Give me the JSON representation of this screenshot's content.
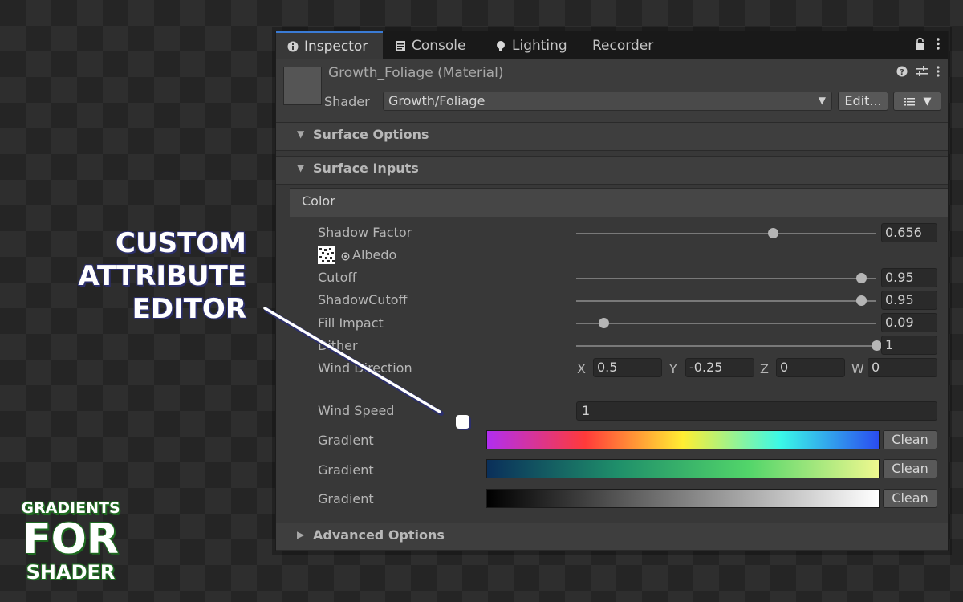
{
  "tabs": [
    {
      "label": "Inspector",
      "icon": "info-icon"
    },
    {
      "label": "Console",
      "icon": "console-icon"
    },
    {
      "label": "Lighting",
      "icon": "lightbulb-icon"
    },
    {
      "label": "Recorder",
      "icon": ""
    }
  ],
  "window_controls": {
    "lock_icon": "lock-icon",
    "menu_icon": "kebab-menu-icon"
  },
  "material": {
    "title": "Growth_Foliage (Material)",
    "shader_label": "Shader",
    "shader_value": "Growth/Foliage",
    "edit_label": "Edit...",
    "header_icons": [
      "help-icon",
      "preset-sliders-icon",
      "kebab-menu-icon"
    ]
  },
  "sections": {
    "surface_options": "Surface Options",
    "surface_inputs": "Surface Inputs",
    "color_header": "Color",
    "advanced_options": "Advanced Options"
  },
  "properties": {
    "shadow_factor": {
      "label": "Shadow Factor",
      "value": "0.656",
      "fraction": 0.656
    },
    "albedo": {
      "label": "Albedo"
    },
    "cutoff": {
      "label": "Cutoff",
      "value": "0.95",
      "fraction": 0.95
    },
    "shadow_cutoff": {
      "label": "ShadowCutoff",
      "value": "0.95",
      "fraction": 0.95
    },
    "fill_impact": {
      "label": "Fill Impact",
      "value": "0.09",
      "fraction": 0.09
    },
    "dither": {
      "label": "Dither",
      "value": "1",
      "fraction": 1.0
    },
    "wind_direction": {
      "label": "Wind Direction",
      "x_label": "X",
      "x": "0.5",
      "y_label": "Y",
      "y": "-0.25",
      "z_label": "Z",
      "z": "0",
      "w_label": "W",
      "w": "0"
    },
    "wind_speed": {
      "label": "Wind Speed",
      "value": "1"
    },
    "gradients": [
      {
        "label": "Gradient",
        "button": "Clean",
        "colors": [
          "#b12ef0",
          "#ff3a3a",
          "#ffee33",
          "#3af8e8",
          "#2a4cf0"
        ]
      },
      {
        "label": "Gradient",
        "button": "Clean",
        "colors": [
          "#0a2f5a",
          "#1f8f6a",
          "#52d56a",
          "#eef88f"
        ]
      },
      {
        "label": "Gradient",
        "button": "Clean",
        "colors": [
          "#000000",
          "#ffffff"
        ]
      }
    ]
  },
  "overlay": {
    "callout_lines": [
      "CUSTOM",
      "ATTRIBUTE",
      "EDITOR"
    ],
    "logo_lines": [
      "GRADIENTS",
      "FOR",
      "SHADER"
    ]
  }
}
